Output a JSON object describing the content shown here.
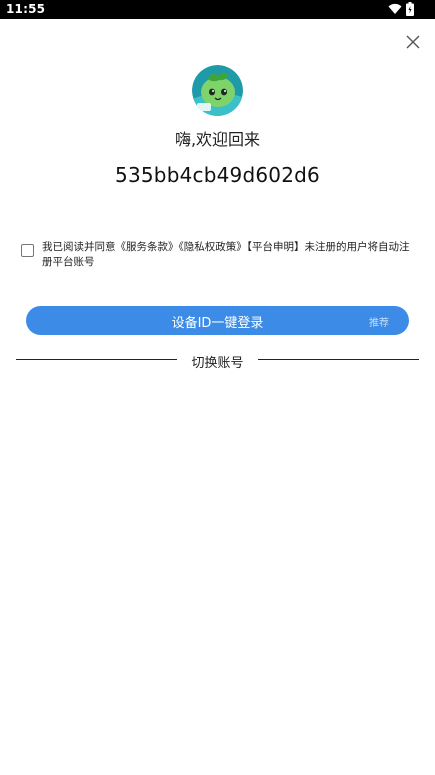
{
  "status_bar": {
    "time": "11:55",
    "icons": [
      "wifi-icon",
      "battery-icon"
    ]
  },
  "header": {
    "close_icon": "close-icon"
  },
  "profile": {
    "avatar": "sprout-mascot-avatar",
    "greeting": "嗨,欢迎回来",
    "device_id": "535bb4cb49d602d6"
  },
  "agreement": {
    "checked": false,
    "prefix": "我已阅读并同意",
    "terms_link": "《服务条款》",
    "privacy_link": "《隐私权政策》",
    "statement_link": "【平台申明】",
    "suffix": "未注册的用户将自动注册平台账号"
  },
  "login": {
    "button_label": "设备ID一键登录",
    "tag": "推荐",
    "accent_color": "#3c8ce7"
  },
  "switch_account": {
    "label": "切换账号"
  }
}
